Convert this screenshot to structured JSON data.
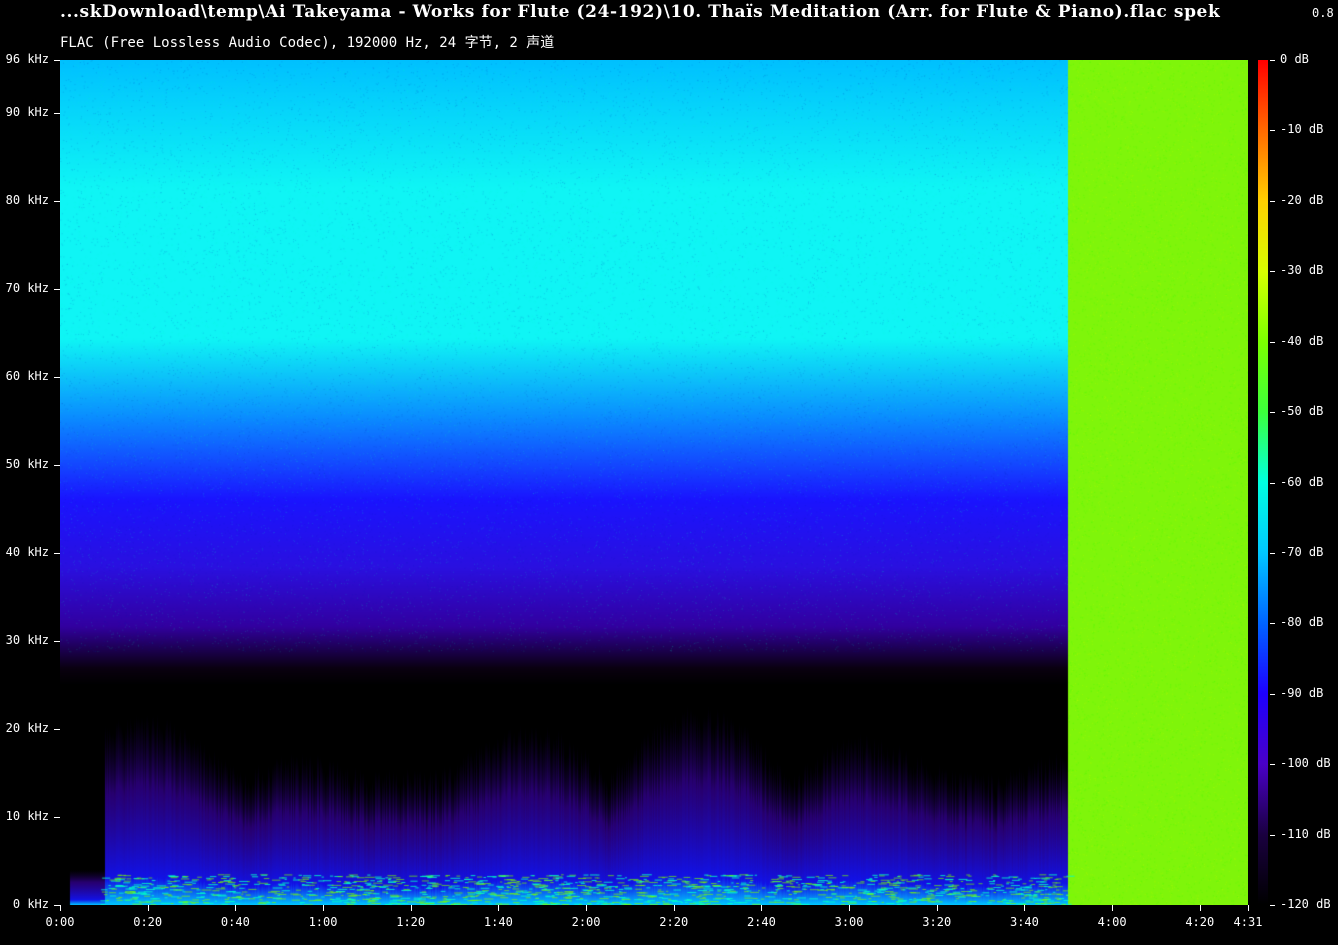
{
  "header": {
    "title": "...skDownload\\temp\\Ai Takeyama - Works for Flute (24-192)\\10. Thaïs Meditation (Arr. for Flute & Piano).flac spek",
    "version": "0.8",
    "subtitle": "FLAC (Free Lossless Audio Codec), 192000 Hz, 24 字节, 2 声道"
  },
  "y_axis": {
    "labels": [
      "96 kHz",
      "90 kHz",
      "80 kHz",
      "70 kHz",
      "60 kHz",
      "50 kHz",
      "40 kHz",
      "30 kHz",
      "20 kHz",
      "10 kHz",
      "0 kHz"
    ],
    "values_khz": [
      96,
      90,
      80,
      70,
      60,
      50,
      40,
      30,
      20,
      10,
      0
    ],
    "max_khz": 96
  },
  "x_axis": {
    "labels": [
      "0:00",
      "0:20",
      "0:40",
      "1:00",
      "1:20",
      "1:40",
      "2:00",
      "2:20",
      "2:40",
      "3:00",
      "3:20",
      "3:40",
      "4:00",
      "4:20",
      "4:31"
    ],
    "values_sec": [
      0,
      20,
      40,
      60,
      80,
      100,
      120,
      140,
      160,
      180,
      200,
      220,
      240,
      260,
      271
    ],
    "max_sec": 271,
    "audio_end_sec": 230
  },
  "colorbar": {
    "labels": [
      "0 dB",
      "-10 dB",
      "-20 dB",
      "-30 dB",
      "-40 dB",
      "-50 dB",
      "-60 dB",
      "-70 dB",
      "-80 dB",
      "-90 dB",
      "-100 dB",
      "-110 dB",
      "-120 dB"
    ],
    "values_db": [
      0,
      -10,
      -20,
      -30,
      -40,
      -50,
      -60,
      -70,
      -80,
      -90,
      -100,
      -110,
      -120
    ],
    "colors": [
      "#ff0000",
      "#ff6a00",
      "#ffd000",
      "#d8ff00",
      "#7cff00",
      "#3cff3c",
      "#00ffe0",
      "#00c8ff",
      "#0064ff",
      "#1e00ff",
      "#4a00c8",
      "#1a0040",
      "#000000"
    ]
  },
  "spectrogram": {
    "padding_color": "#7ff50a",
    "band_colors": {
      "top": "#00c0ff",
      "mid": "#0ff5f5",
      "low": "#1a14ff",
      "violet": "#3200a0",
      "floor": "#000000"
    }
  }
}
